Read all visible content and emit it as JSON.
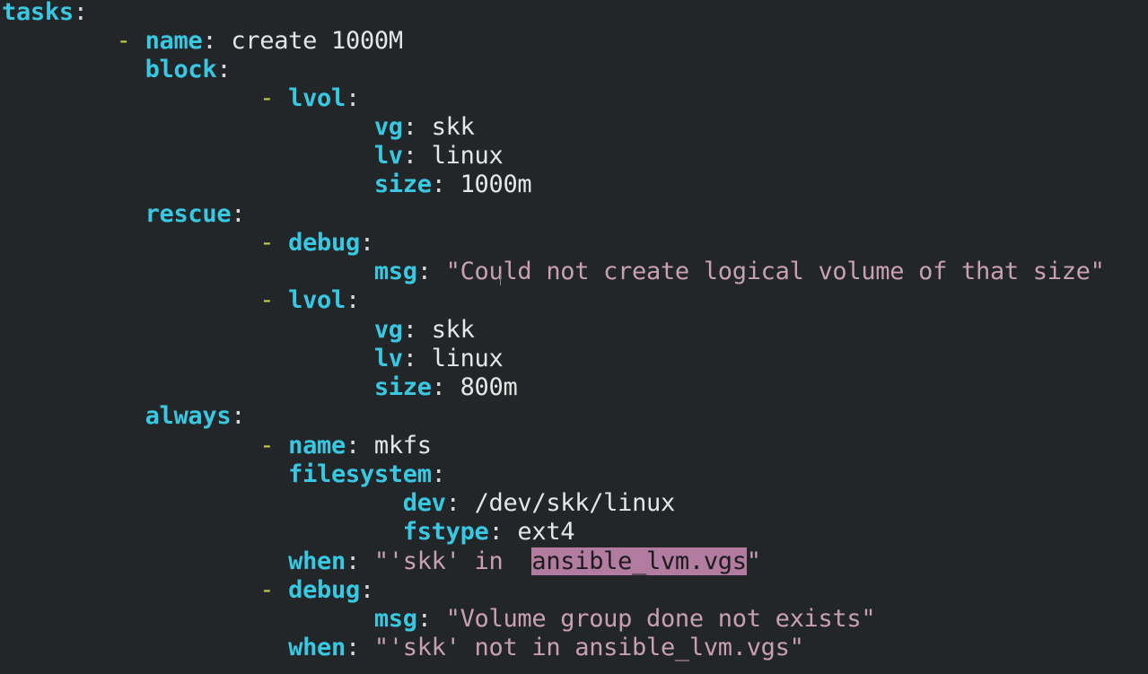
{
  "editor": {
    "mode": "yaml",
    "colors": {
      "background": "#232628",
      "key": "#38c8e2",
      "dash": "#c7c94a",
      "value": "#e6e6e6",
      "string": "#c7a0b4",
      "search_highlight": "#b27ba0"
    },
    "lines": [
      {
        "key": "tasks"
      },
      {
        "key": "name",
        "value": "create 1000M"
      },
      {
        "key": "block"
      },
      {
        "key": "lvol"
      },
      {
        "key": "vg",
        "value": "skk"
      },
      {
        "key": "lv",
        "value": "linux"
      },
      {
        "key": "size",
        "value": "1000m"
      },
      {
        "key": "rescue"
      },
      {
        "key": "debug"
      },
      {
        "key": "msg",
        "value": "\"Could not create logical volume of that size\""
      },
      {
        "key": "lvol"
      },
      {
        "key": "vg",
        "value": "skk"
      },
      {
        "key": "lv",
        "value": "linux"
      },
      {
        "key": "size",
        "value": "800m"
      },
      {
        "key": "always"
      },
      {
        "key": "name",
        "value": "mkfs"
      },
      {
        "key": "filesystem"
      },
      {
        "key": "dev",
        "value": "/dev/skk/linux"
      },
      {
        "key": "fstype",
        "value": "ext4"
      },
      {
        "key": "when",
        "value_before": "\"'skk' in  ",
        "value_highlight": "ansible_lvm.vgs",
        "value_after": "\""
      },
      {
        "key": "debug"
      },
      {
        "key": "msg",
        "value": "\"Volume group done not exists\""
      },
      {
        "key": "when",
        "value": "\"'skk' not in ansible_lvm.vgs\""
      }
    ]
  }
}
